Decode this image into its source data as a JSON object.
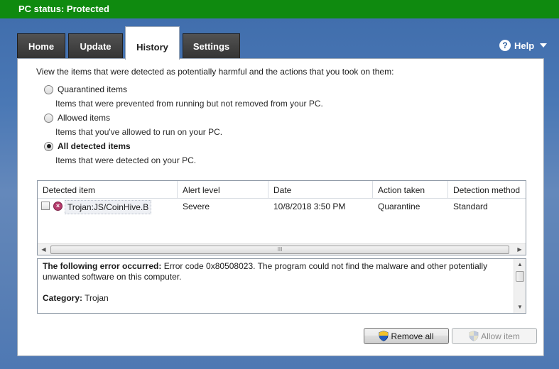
{
  "titlebar": {
    "label": "PC status:",
    "status": "Protected"
  },
  "tabs": [
    {
      "label": "Home",
      "active": false
    },
    {
      "label": "Update",
      "active": false
    },
    {
      "label": "History",
      "active": true
    },
    {
      "label": "Settings",
      "active": false
    }
  ],
  "help": {
    "label": "Help",
    "icon": "help-icon"
  },
  "intro": "View the items that were detected as potentially harmful and the actions that you took on them:",
  "options": [
    {
      "label": "Quarantined items",
      "desc": "Items that were prevented from running but not removed from your PC.",
      "checked": false
    },
    {
      "label": "Allowed items",
      "desc": "Items that you've allowed to run on your PC.",
      "checked": false
    },
    {
      "label": "All detected items",
      "desc": "Items that were detected on your PC.",
      "checked": true
    }
  ],
  "list": {
    "columns": [
      "Detected item",
      "Alert level",
      "Date",
      "Action taken",
      "Detection method"
    ],
    "rows": [
      {
        "item": "Trojan:JS/CoinHive.B",
        "alert": "Severe",
        "date": "10/8/2018 3:50 PM",
        "action": "Quarantine",
        "method": "Standard",
        "checked": false
      }
    ],
    "scroll_grip": "III"
  },
  "details": {
    "error_label": "The following error occurred:",
    "error_text": " Error code 0x80508023. The program could not find the malware and other potentially unwanted software on this computer.",
    "category_label": "Category:",
    "category_value": " Trojan"
  },
  "buttons": {
    "remove_all": "Remove all",
    "allow_item": "Allow item"
  },
  "colors": {
    "titlebar": "#0f8a0f",
    "threat": "#b63d6d",
    "tab_inactive": "#3a3a3a"
  }
}
